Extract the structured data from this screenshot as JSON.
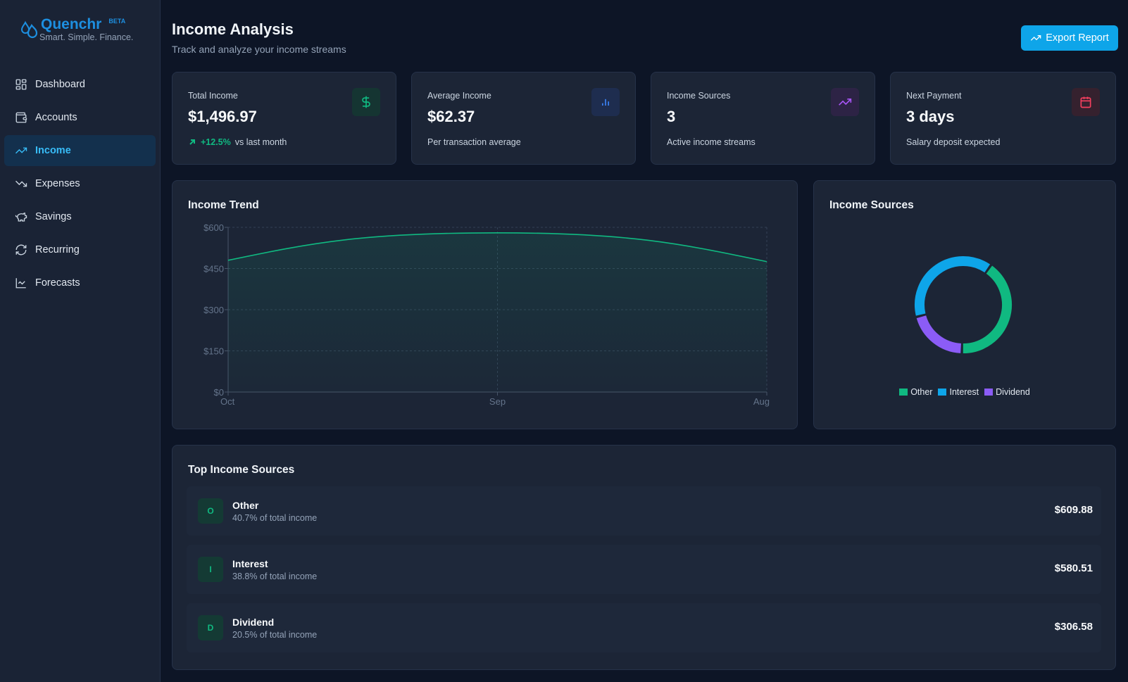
{
  "brand": {
    "name": "Quenchr",
    "badge": "BETA",
    "tagline": "Smart. Simple. Finance."
  },
  "nav": [
    {
      "label": "Dashboard",
      "icon": "grid-icon"
    },
    {
      "label": "Accounts",
      "icon": "wallet-icon"
    },
    {
      "label": "Income",
      "icon": "trending-up-icon",
      "active": true
    },
    {
      "label": "Expenses",
      "icon": "trending-down-icon"
    },
    {
      "label": "Savings",
      "icon": "piggy-bank-icon"
    },
    {
      "label": "Recurring",
      "icon": "refresh-icon"
    },
    {
      "label": "Forecasts",
      "icon": "line-chart-icon"
    }
  ],
  "header": {
    "title": "Income Analysis",
    "subtitle": "Track and analyze your income streams",
    "export_label": "Export Report"
  },
  "stats": [
    {
      "label": "Total Income",
      "value": "$1,496.97",
      "trend": "+12.5%",
      "sub": "vs last month",
      "icon": "dollar-icon",
      "color": "#10b981",
      "bg": "#153532"
    },
    {
      "label": "Average Income",
      "value": "$62.37",
      "sub": "Per transaction average",
      "icon": "bar-chart-icon",
      "color": "#3b82f6",
      "bg": "#1e2d4f"
    },
    {
      "label": "Income Sources",
      "value": "3",
      "sub": "Active income streams",
      "icon": "trending-up-icon",
      "color": "#a855f7",
      "bg": "#2d2345"
    },
    {
      "label": "Next Payment",
      "value": "3 days",
      "sub": "Salary deposit expected",
      "icon": "calendar-icon",
      "color": "#f43f5e",
      "bg": "#35212e"
    }
  ],
  "trend_chart": {
    "title": "Income Trend",
    "chart_data": {
      "type": "area",
      "x": [
        "Oct",
        "Sep",
        "Aug"
      ],
      "values": [
        480,
        580,
        475
      ],
      "yticks": [
        "$0",
        "$150",
        "$300",
        "$450",
        "$600"
      ],
      "ylim": [
        0,
        600
      ],
      "grid": true,
      "color": "#10b981"
    }
  },
  "sources_chart": {
    "title": "Income Sources",
    "chart_data": {
      "type": "pie",
      "categories": [
        "Other",
        "Interest",
        "Dividend"
      ],
      "values": [
        609.88,
        580.51,
        306.58
      ],
      "colors": [
        "#10b981",
        "#0ea5e9",
        "#8b5cf6"
      ],
      "legend": "bottom"
    }
  },
  "top_sources": {
    "title": "Top Income Sources",
    "items": [
      {
        "initial": "O",
        "name": "Other",
        "pct": "40.7% of total income",
        "amount": "$609.88"
      },
      {
        "initial": "I",
        "name": "Interest",
        "pct": "38.8% of total income",
        "amount": "$580.51"
      },
      {
        "initial": "D",
        "name": "Dividend",
        "pct": "20.5% of total income",
        "amount": "$306.58"
      }
    ]
  }
}
